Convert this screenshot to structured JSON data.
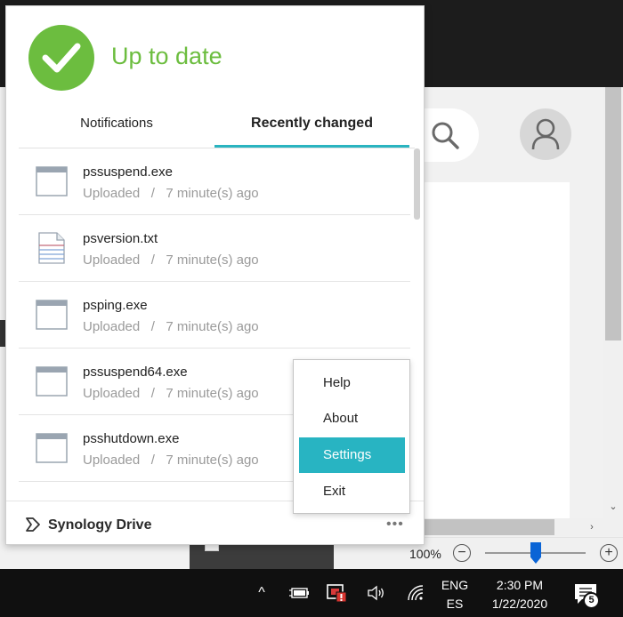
{
  "sync_panel": {
    "status_text": "Up to date",
    "status_color": "#6cbd3f",
    "tabs": [
      {
        "label": "Notifications",
        "active": false
      },
      {
        "label": "Recently changed",
        "active": true
      }
    ],
    "accent_color": "#2ab4c0",
    "files": [
      {
        "name": "pssuspend.exe",
        "action": "Uploaded",
        "separator": "/",
        "time": "7 minute(s) ago",
        "icon": "window-file-icon"
      },
      {
        "name": "psversion.txt",
        "action": "Uploaded",
        "separator": "/",
        "time": "7 minute(s) ago",
        "icon": "text-file-icon"
      },
      {
        "name": "psping.exe",
        "action": "Uploaded",
        "separator": "/",
        "time": "7 minute(s) ago",
        "icon": "window-file-icon"
      },
      {
        "name": "pssuspend64.exe",
        "action": "Uploaded",
        "separator": "/",
        "time": "7 minute(s) ago",
        "icon": "window-file-icon"
      },
      {
        "name": "psshutdown.exe",
        "action": "Uploaded",
        "separator": "/",
        "time": "7 minute(s) ago",
        "icon": "window-file-icon"
      }
    ],
    "footer": {
      "brand": "Synology Drive",
      "more_label": "•••"
    }
  },
  "context_menu": {
    "items": [
      {
        "label": "Help",
        "active": false
      },
      {
        "label": "About",
        "active": false
      },
      {
        "label": "Settings",
        "active": true
      },
      {
        "label": "Exit",
        "active": false
      }
    ]
  },
  "background_app": {
    "zoom_level": "100%",
    "zoom_out_label": "−",
    "zoom_in_label": "+",
    "zoom_fraction": 0.5,
    "scroll_down_glyph": "⌄",
    "scroll_right_glyph": "›"
  },
  "taskbar": {
    "language": "ENG",
    "keyboard": "ES",
    "time": "2:30 PM",
    "date": "1/22/2020",
    "notification_count": "5",
    "chevron_glyph": "^"
  }
}
